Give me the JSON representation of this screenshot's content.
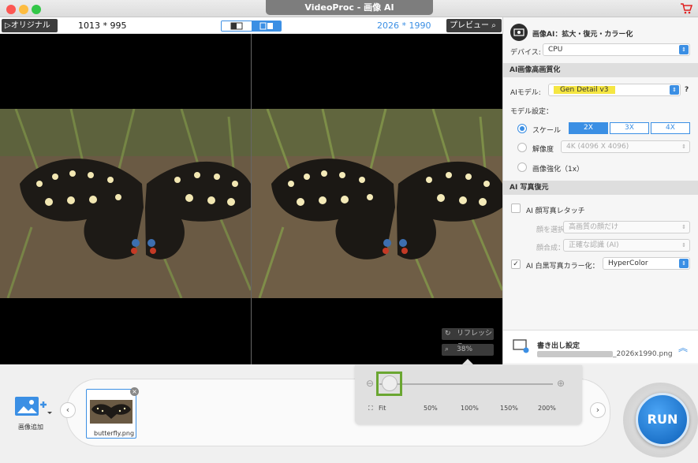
{
  "window": {
    "title": "VideoProc - 画像 AI",
    "cart_icon": "cart-icon",
    "traffic_lights": [
      "#fc5753",
      "#fdbc40",
      "#33c748"
    ]
  },
  "preview": {
    "original_label": "オリジナル",
    "original_dims": "1013 * 995",
    "output_dims": "2026 * 1990",
    "preview_label": "プレビュー",
    "refresh_label": "リフレッシュ",
    "zoom_value": "38%"
  },
  "panel": {
    "header_title": "画像AI：拡大・復元・カラー化",
    "device_label": "デバイス:",
    "device_value": "CPU",
    "upscale_section": "AI画像高画質化",
    "model_label": "AIモデル:",
    "model_value": "Gen Detail v3",
    "help_label": "?",
    "model_settings_label": "モデル設定：",
    "scale_label": "スケール",
    "scale_options": [
      "2X",
      "3X",
      "4X"
    ],
    "scale_selected": "2X",
    "resolution_label": "解像度",
    "resolution_value": "4K (4096 X 4096)",
    "enhance_label": "画像強化（1x）",
    "restore_section": "AI 写真復元",
    "face_retouch_label": "AI 顔写真レタッチ",
    "face_select_label": "顔を選択:",
    "face_select_value": "高画質の顔だけ",
    "face_blend_label": "顔合成：",
    "face_blend_value": "正確な認識 (AI)",
    "colorize_label": "AI 白黒写真カラー化：",
    "colorize_checked": true,
    "colorize_value": "HyperColor",
    "export_title": "書き出し設定",
    "export_filename": "_2026x1990.png"
  },
  "bottom": {
    "add_image_label": "画像追加",
    "thumb_name": "butterfly.png",
    "run_label": "RUN",
    "zoom_labels": [
      "Fit",
      "50%",
      "100%",
      "150%",
      "200%"
    ],
    "zoom_slider_value": 0.05
  },
  "colors": {
    "accent": "#3b8fe4",
    "highlight": "#f5e642",
    "thumb_outline": "#6aa631"
  }
}
